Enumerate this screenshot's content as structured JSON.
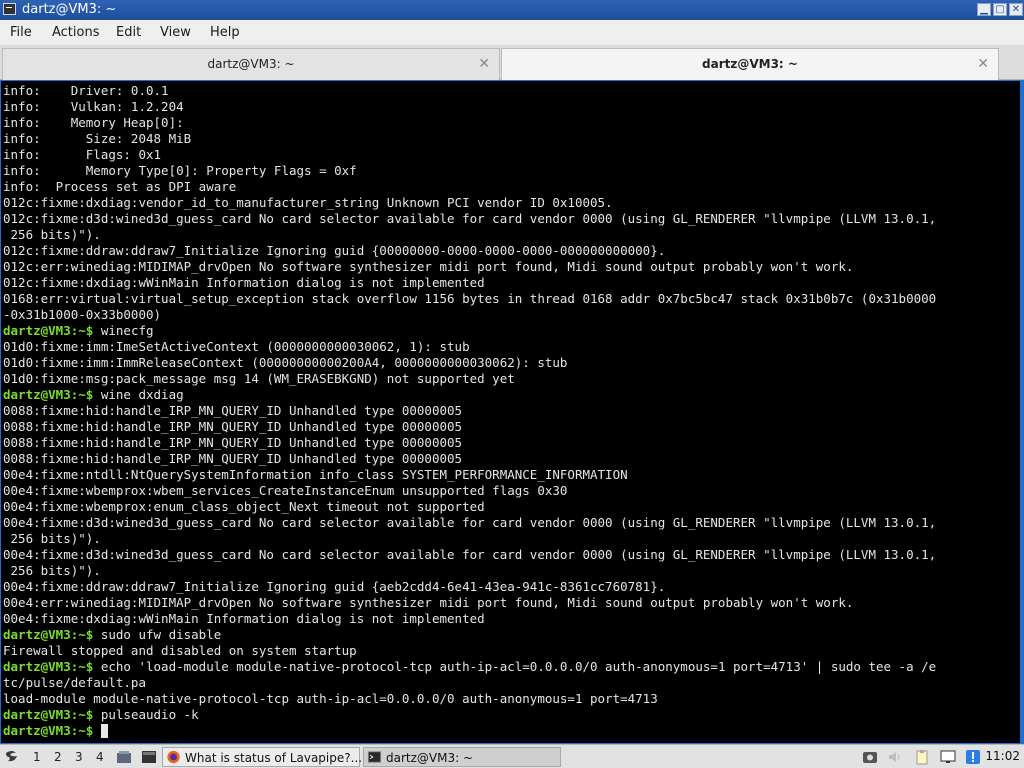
{
  "window": {
    "title": "dartz@VM3: ~"
  },
  "menu": {
    "file": "File",
    "actions": "Actions",
    "edit": "Edit",
    "view": "View",
    "help": "Help"
  },
  "tabs": [
    {
      "label": "dartz@VM3: ~"
    },
    {
      "label": "dartz@VM3: ~"
    }
  ],
  "terminal": {
    "lines": [
      [
        {
          "t": "info:    Driver: 0.0.1"
        }
      ],
      [
        {
          "t": "info:    Vulkan: 1.2.204"
        }
      ],
      [
        {
          "t": "info:    Memory Heap[0]:"
        }
      ],
      [
        {
          "t": "info:      Size: 2048 MiB"
        }
      ],
      [
        {
          "t": "info:      Flags: 0x1"
        }
      ],
      [
        {
          "t": "info:      Memory Type[0]: Property Flags = 0xf"
        }
      ],
      [
        {
          "t": "info:  Process set as DPI aware"
        }
      ],
      [
        {
          "t": "012c:fixme:dxdiag:vendor_id_to_manufacturer_string Unknown PCI vendor ID 0x10005."
        }
      ],
      [
        {
          "t": "012c:fixme:d3d:wined3d_guess_card No card selector available for card vendor 0000 (using GL_RENDERER \"llvmpipe (LLVM 13.0.1,"
        }
      ],
      [
        {
          "t": " 256 bits)\")."
        }
      ],
      [
        {
          "t": "012c:fixme:ddraw:ddraw7_Initialize Ignoring guid {00000000-0000-0000-0000-000000000000}."
        }
      ],
      [
        {
          "t": "012c:err:winediag:MIDIMAP_drvOpen No software synthesizer midi port found, Midi sound output probably won't work."
        }
      ],
      [
        {
          "t": "012c:fixme:dxdiag:wWinMain Information dialog is not implemented"
        }
      ],
      [
        {
          "t": "0168:err:virtual:virtual_setup_exception stack overflow 1156 bytes in thread 0168 addr 0x7bc5bc47 stack 0x31b0b7c (0x31b0000"
        }
      ],
      [
        {
          "t": "-0x31b1000-0x33b0000)"
        }
      ],
      [
        {
          "p": "dartz@VM3:~$"
        },
        {
          "t": " winecfg"
        }
      ],
      [
        {
          "t": "01d0:fixme:imm:ImeSetActiveContext (0000000000030062, 1): stub"
        }
      ],
      [
        {
          "t": "01d0:fixme:imm:ImmReleaseContext (00000000000200A4, 0000000000030062): stub"
        }
      ],
      [
        {
          "t": "01d0:fixme:msg:pack_message msg 14 (WM_ERASEBKGND) not supported yet"
        }
      ],
      [
        {
          "p": "dartz@VM3:~$"
        },
        {
          "t": " wine dxdiag"
        }
      ],
      [
        {
          "t": "0088:fixme:hid:handle_IRP_MN_QUERY_ID Unhandled type 00000005"
        }
      ],
      [
        {
          "t": "0088:fixme:hid:handle_IRP_MN_QUERY_ID Unhandled type 00000005"
        }
      ],
      [
        {
          "t": "0088:fixme:hid:handle_IRP_MN_QUERY_ID Unhandled type 00000005"
        }
      ],
      [
        {
          "t": "0088:fixme:hid:handle_IRP_MN_QUERY_ID Unhandled type 00000005"
        }
      ],
      [
        {
          "t": "00e4:fixme:ntdll:NtQuerySystemInformation info_class SYSTEM_PERFORMANCE_INFORMATION"
        }
      ],
      [
        {
          "t": "00e4:fixme:wbemprox:wbem_services_CreateInstanceEnum unsupported flags 0x30"
        }
      ],
      [
        {
          "t": "00e4:fixme:wbemprox:enum_class_object_Next timeout not supported"
        }
      ],
      [
        {
          "t": "00e4:fixme:d3d:wined3d_guess_card No card selector available for card vendor 0000 (using GL_RENDERER \"llvmpipe (LLVM 13.0.1,"
        }
      ],
      [
        {
          "t": " 256 bits)\")."
        }
      ],
      [
        {
          "t": "00e4:fixme:d3d:wined3d_guess_card No card selector available for card vendor 0000 (using GL_RENDERER \"llvmpipe (LLVM 13.0.1,"
        }
      ],
      [
        {
          "t": " 256 bits)\")."
        }
      ],
      [
        {
          "t": "00e4:fixme:ddraw:ddraw7_Initialize Ignoring guid {aeb2cdd4-6e41-43ea-941c-8361cc760781}."
        }
      ],
      [
        {
          "t": "00e4:err:winediag:MIDIMAP_drvOpen No software synthesizer midi port found, Midi sound output probably won't work."
        }
      ],
      [
        {
          "t": "00e4:fixme:dxdiag:wWinMain Information dialog is not implemented"
        }
      ],
      [
        {
          "p": "dartz@VM3:~$"
        },
        {
          "t": " sudo ufw disable"
        }
      ],
      [
        {
          "t": "Firewall stopped and disabled on system startup"
        }
      ],
      [
        {
          "p": "dartz@VM3:~$"
        },
        {
          "t": " echo 'load-module module-native-protocol-tcp auth-ip-acl=0.0.0.0/0 auth-anonymous=1 port=4713' | sudo tee -a /e"
        }
      ],
      [
        {
          "t": "tc/pulse/default.pa"
        }
      ],
      [
        {
          "t": "load-module module-native-protocol-tcp auth-ip-acl=0.0.0.0/0 auth-anonymous=1 port=4713"
        }
      ],
      [
        {
          "p": "dartz@VM3:~$"
        },
        {
          "t": " pulseaudio -k"
        }
      ],
      [
        {
          "p": "dartz@VM3:~$"
        },
        {
          "t": " "
        }
      ]
    ]
  },
  "taskbar": {
    "workspaces": [
      "1",
      "2",
      "3",
      "4"
    ],
    "tasks": [
      {
        "label": "What is status of Lavapipe?..."
      },
      {
        "label": "dartz@VM3: ~"
      }
    ],
    "clock": "11:02"
  }
}
